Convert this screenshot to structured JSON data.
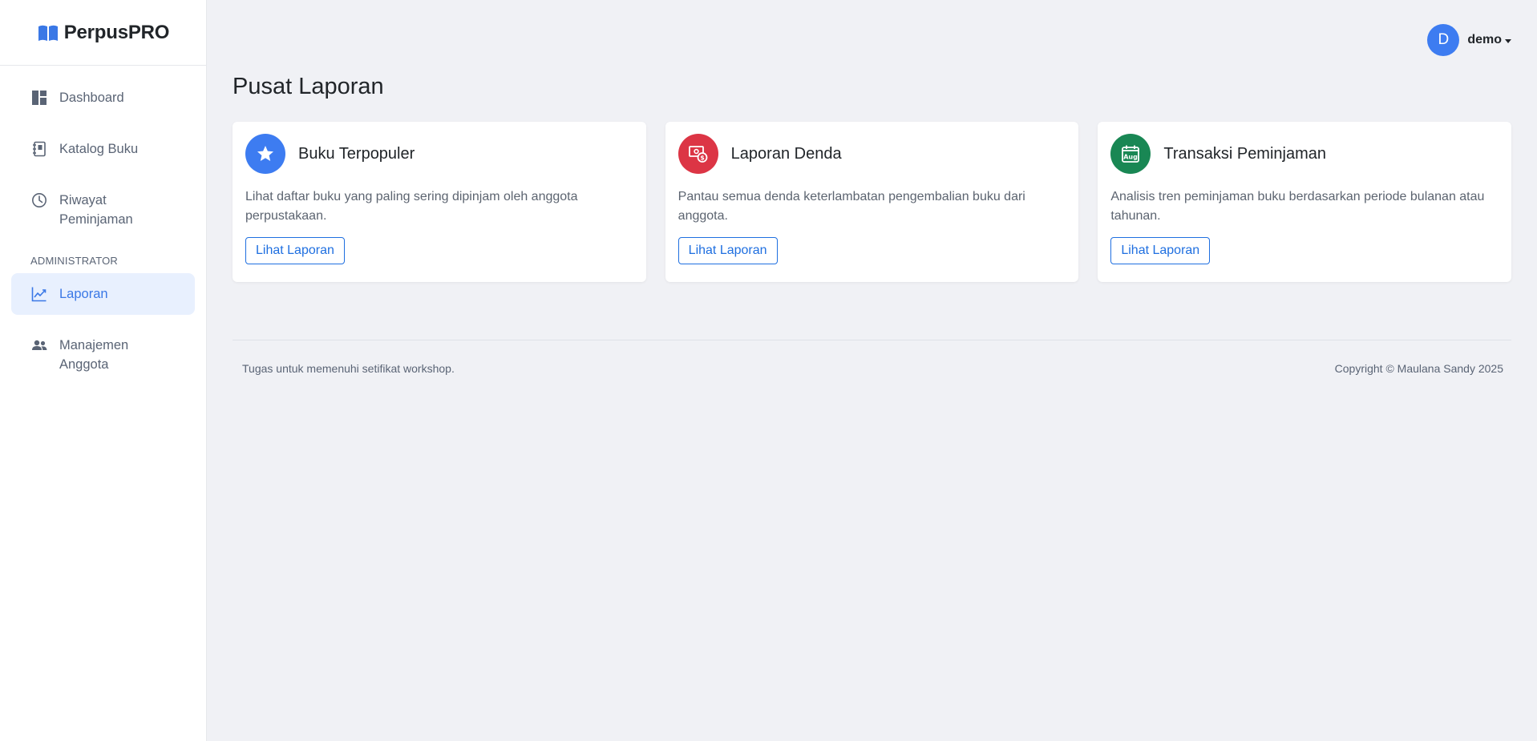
{
  "brand": {
    "name": "PerpusPRO",
    "icon": "book-open-icon",
    "color": "#3a78e6"
  },
  "sidebar": {
    "items": [
      {
        "label": "Dashboard",
        "icon": "dashboard-icon"
      },
      {
        "label": "Katalog Buku",
        "icon": "book-icon"
      },
      {
        "label": "Riwayat Peminjaman",
        "icon": "clock-icon"
      }
    ],
    "section_label": "ADMINISTRATOR",
    "admin_items": [
      {
        "label": "Laporan",
        "icon": "chart-line-icon",
        "active": true
      },
      {
        "label": "Manajemen Anggota",
        "icon": "people-icon"
      }
    ]
  },
  "user": {
    "initial": "D",
    "name": "demo"
  },
  "page": {
    "title": "Pusat Laporan"
  },
  "cards": [
    {
      "title": "Buku Terpopuler",
      "description": "Lihat daftar buku yang paling sering dipinjam oleh anggota perpustakaan.",
      "button": "Lihat Laporan",
      "icon": "star-icon",
      "color": "#3d7cf1"
    },
    {
      "title": "Laporan Denda",
      "description": "Pantau semua denda keterlambatan pengembalian buku dari anggota.",
      "button": "Lihat Laporan",
      "icon": "cash-coin-icon",
      "color": "#dc3545"
    },
    {
      "title": "Transaksi Peminjaman",
      "description": "Analisis tren peminjaman buku berdasarkan periode bulanan atau tahunan.",
      "button": "Lihat Laporan",
      "icon": "calendar-month-icon",
      "icon_text": "Aug",
      "color": "#198754"
    }
  ],
  "footer": {
    "left": "Tugas untuk memenuhi setifikat workshop.",
    "right": "Copyright © Maulana Sandy 2025"
  }
}
